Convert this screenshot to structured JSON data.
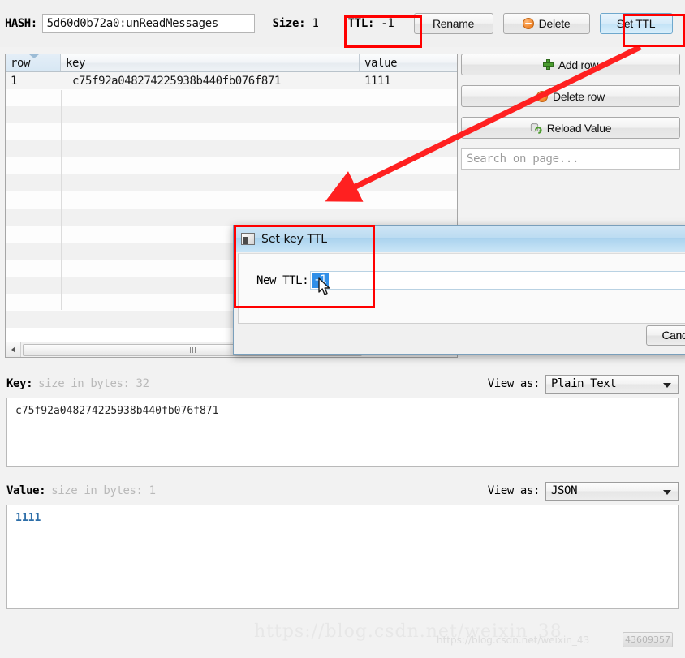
{
  "toolbar": {
    "hash_label": "HASH:",
    "hash_value": "5d60d0b72a0:unReadMessages",
    "size_label": "Size:",
    "size_value": "1",
    "ttl_label": "TTL:",
    "ttl_value": "-1",
    "rename_label": "Rename",
    "delete_label": "Delete",
    "set_ttl_label": "Set TTL"
  },
  "table": {
    "columns": [
      "row",
      "key",
      "value"
    ],
    "rows": [
      {
        "row": "1",
        "key": "c75f92a048274225938b440fb076f871",
        "value": "1111"
      }
    ],
    "empty_row_count": 14,
    "scrollbar": {
      "left_arrow": "left-arrow"
    }
  },
  "side_panel": {
    "add_row_label": "Add row",
    "delete_row_label": "Delete row",
    "reload_value_label": "Reload Value",
    "search_placeholder": "Search on page..."
  },
  "key_panel": {
    "label": "Key:",
    "size_text": "size in bytes: 32",
    "view_as_label": "View as:",
    "view_as_value": "Plain Text",
    "content": "c75f92a048274225938b440fb076f871"
  },
  "value_panel": {
    "label": "Value:",
    "size_text": "size in bytes: 1",
    "view_as_label": "View as:",
    "view_as_value": "JSON",
    "content": "1111"
  },
  "dialog": {
    "title": "Set key TTL",
    "field_label": "New TTL:",
    "field_value": "-1",
    "cancel_label": "Canc"
  },
  "watermark": {
    "line1": "https://blog.csdn.net/weixin_38",
    "line2": "https://blog.csdn.net/weixin_43",
    "badge": "43609357"
  },
  "colors": {
    "annotation": "#ff0000",
    "selection": "#2f8fe8",
    "value_text": "#2d6ea8",
    "selected_button": "#c2e2f6"
  }
}
